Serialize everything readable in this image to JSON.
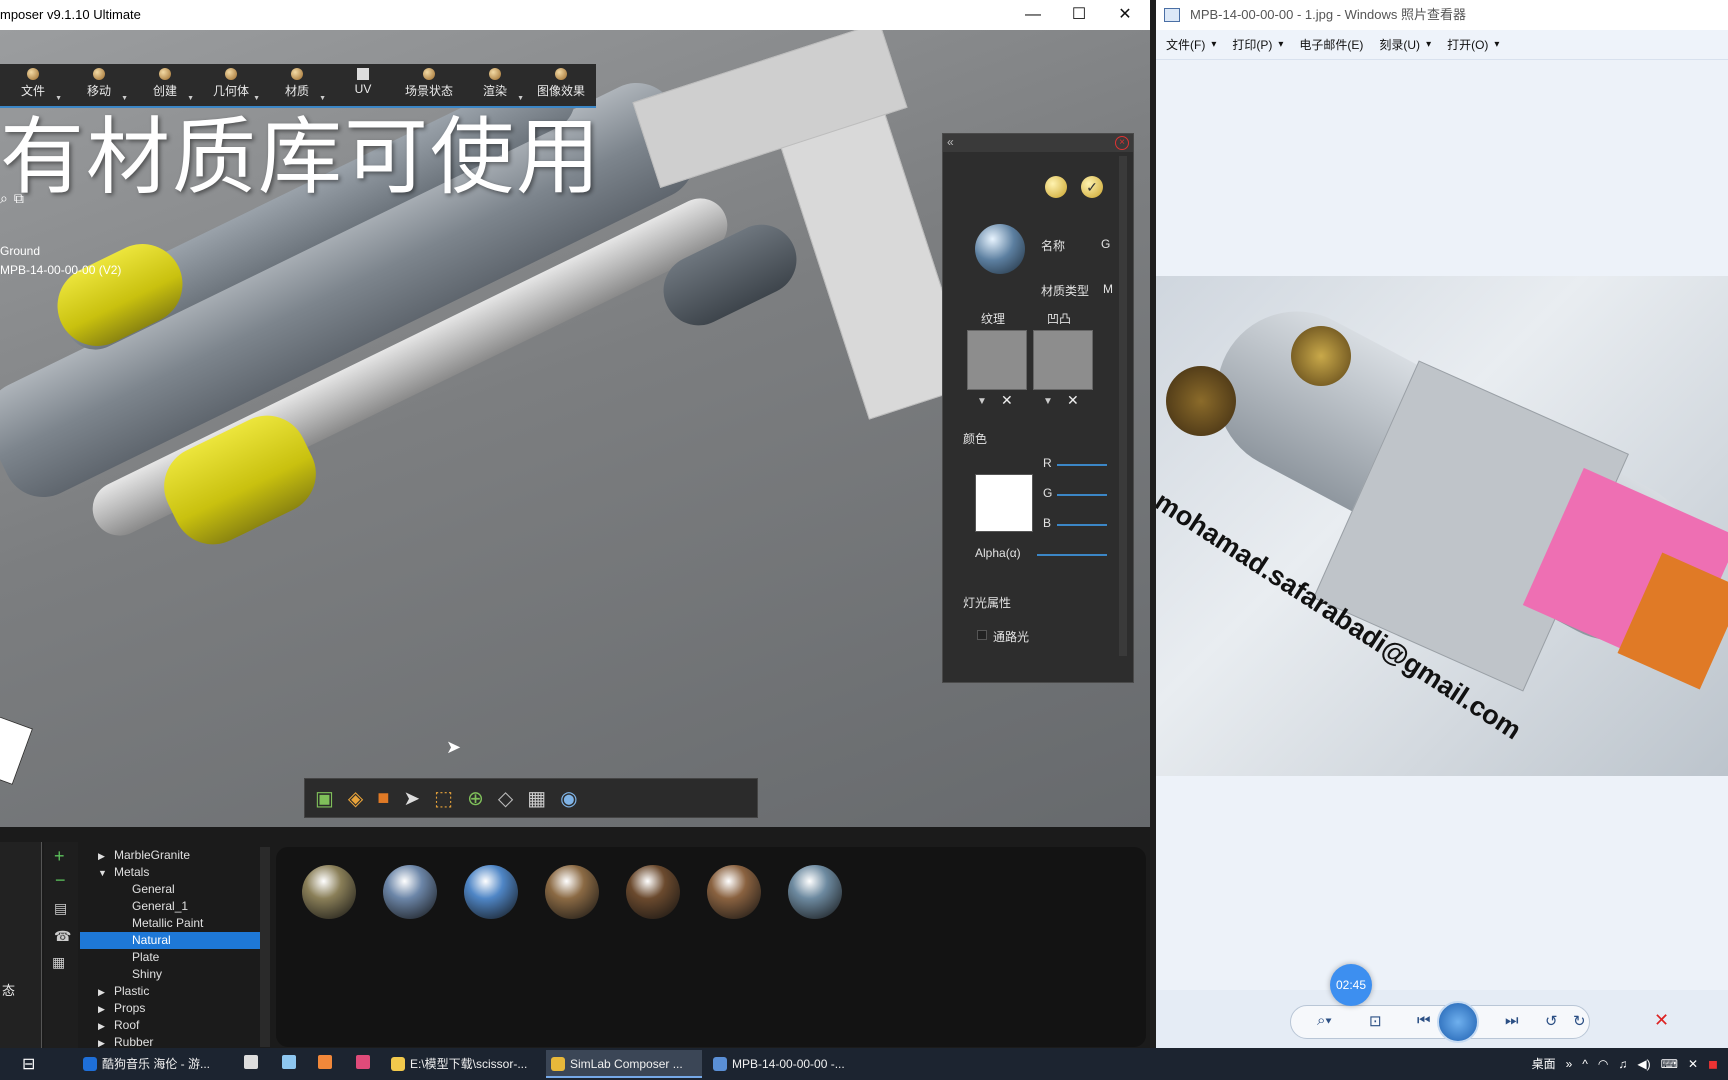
{
  "simlab": {
    "title": "mposer v9.1.10 Ultimate",
    "toolbar": [
      {
        "label": "文件"
      },
      {
        "label": "移动"
      },
      {
        "label": "创建"
      },
      {
        "label": "几何体"
      },
      {
        "label": "材质"
      },
      {
        "label": "UV"
      },
      {
        "label": "场景状态"
      },
      {
        "label": "渲染"
      },
      {
        "label": "图像效果"
      }
    ],
    "caption": "有材质库可使用",
    "scene_tree": {
      "ground": "Ground",
      "model": "MPB-14-00-00-00 (V2)"
    }
  },
  "material_panel": {
    "name_label": "名称",
    "name_value": "G",
    "type_label": "材质类型",
    "type_value": "M",
    "texture_label": "纹理",
    "bump_label": "凹凸",
    "color_label": "颜色",
    "r_label": "R",
    "g_label": "G",
    "b_label": "B",
    "alpha_label": "Alpha(α)",
    "light_label": "灯光属性",
    "passthrough_label": "通路光"
  },
  "library": {
    "tree": [
      {
        "label": "MarbleGranite",
        "level": 1,
        "expanded": false
      },
      {
        "label": "Metals",
        "level": 1,
        "expanded": true
      },
      {
        "label": "General",
        "level": 2
      },
      {
        "label": "General_1",
        "level": 2
      },
      {
        "label": "Metallic Paint",
        "level": 2
      },
      {
        "label": "Natural",
        "level": 2,
        "selected": true
      },
      {
        "label": "Plate",
        "level": 2
      },
      {
        "label": "Shiny",
        "level": 2
      },
      {
        "label": "Plastic",
        "level": 1,
        "expanded": false
      },
      {
        "label": "Props",
        "level": 1,
        "expanded": false
      },
      {
        "label": "Roof",
        "level": 1,
        "expanded": false
      },
      {
        "label": "Rubber",
        "level": 1,
        "expanded": false
      }
    ],
    "left_label": "态",
    "material_colors": [
      "#8a7f58",
      "#6c86a8",
      "#4f86c6",
      "#8b6a44",
      "#6b4a2e",
      "#8a6240",
      "#6d8aa0"
    ]
  },
  "viewer": {
    "title": "MPB-14-00-00-00 - 1.jpg - Windows 照片查看器",
    "menu": [
      "文件(F)",
      "打印(P)",
      "电子邮件(E)",
      "刻录(U)",
      "打开(O)"
    ],
    "watermark": "mohamad.safarabadi@gmail.com",
    "time": "02:45"
  },
  "taskbar": {
    "tasks": [
      {
        "label": "酷狗音乐 海伦 - 游...",
        "color": "#1e6fd9"
      },
      {
        "label": "E:\\模型下载\\scissor-...",
        "color": "#f2c94c"
      },
      {
        "label": "SimLab Composer ...",
        "color": "#e8b83a",
        "active": true
      },
      {
        "label": "MPB-14-00-00-00 -...",
        "color": "#5a8fd6"
      }
    ],
    "tray_desktop": "桌面"
  },
  "colors": {
    "accent": "#3b86c6",
    "selection": "#1e78d7",
    "cylinder_yellow": "#d4cd1a"
  }
}
